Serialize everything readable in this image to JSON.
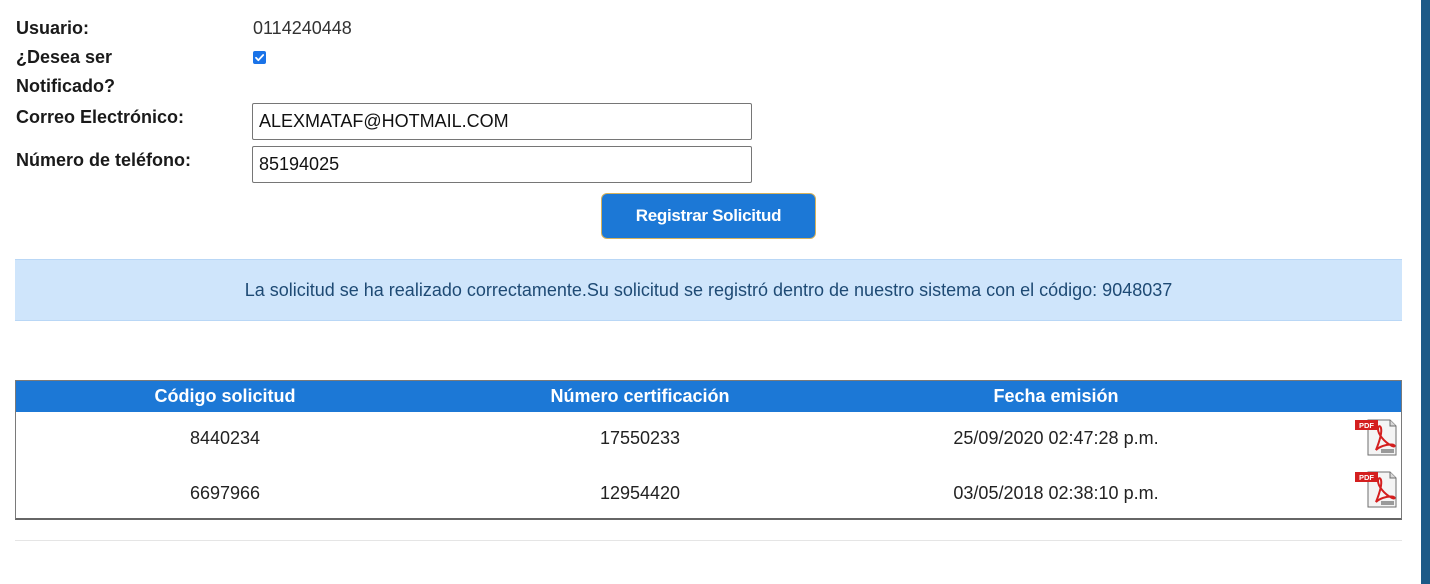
{
  "form": {
    "usuario_label": "Usuario:",
    "usuario_value": "0114240448",
    "notificado_label_line1": "¿Desea ser",
    "notificado_label_line2": "Notificado?",
    "notificado_checked": true,
    "correo_label": "Correo Electrónico:",
    "correo_value": "ALEXMATAF@HOTMAIL.COM",
    "telefono_label": "Número de teléfono:",
    "telefono_value": "85194025",
    "submit_label": "Registrar Solicitud"
  },
  "alert": {
    "message": "La solicitud se ha realizado correctamente.Su solicitud se registró dentro de nuestro sistema con el código: 9048037"
  },
  "table": {
    "headers": [
      "Código solicitud",
      "Número certificación",
      "Fecha emisión"
    ],
    "rows": [
      {
        "codigo": "8440234",
        "numero": "17550233",
        "fecha": "25/09/2020 02:47:28 p.m.",
        "icon": "pdf-icon",
        "icon_text": "PDF"
      },
      {
        "codigo": "6697966",
        "numero": "12954420",
        "fecha": "03/05/2018 02:38:10 p.m.",
        "icon": "pdf-icon",
        "icon_text": "PDF"
      }
    ]
  },
  "colors": {
    "primary": "#1c78d6",
    "alert_bg": "#cfe5fb",
    "alert_text": "#1e4a74",
    "sidebar": "#1c5a87"
  }
}
